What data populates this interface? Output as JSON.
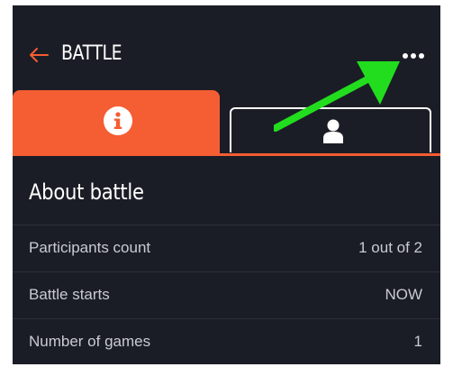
{
  "colors": {
    "background": "#1b1d26",
    "accent": "#f55d32",
    "text_primary": "#ffffff",
    "text_secondary": "#c9cbd1",
    "annotation_arrow": "#22dd1e"
  },
  "header": {
    "back_icon": "arrow-left-icon",
    "title": "BATTLE",
    "more_icon": "more-horizontal-icon"
  },
  "tabs": [
    {
      "id": "info",
      "icon": "info-icon",
      "active": true
    },
    {
      "id": "participants",
      "icon": "person-icon",
      "active": false
    }
  ],
  "about": {
    "title": "About battle",
    "rows": [
      {
        "label": "Participants count",
        "value": "1 out of 2"
      },
      {
        "label": "Battle starts",
        "value": "NOW"
      },
      {
        "label": "Number of games",
        "value": "1"
      }
    ]
  }
}
